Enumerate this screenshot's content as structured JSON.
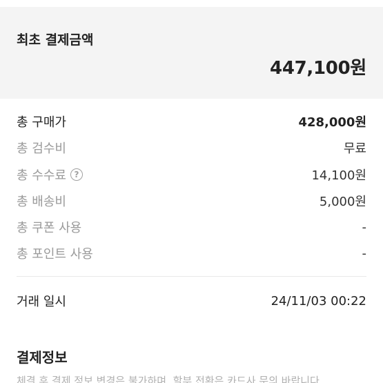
{
  "summary": {
    "title": "최초 결제금액",
    "amount": "447,100원"
  },
  "breakdown": [
    {
      "label": "총 구매가",
      "value": "428,000원"
    },
    {
      "label": "총 검수비",
      "value": "무료"
    },
    {
      "label": "총 수수료",
      "value": "14,100원",
      "icon": "question-circle-icon"
    },
    {
      "label": "총 배송비",
      "value": "5,000원"
    },
    {
      "label": "총 쿠폰 사용",
      "value": "-"
    },
    {
      "label": "총 포인트 사용",
      "value": "-"
    }
  ],
  "transaction": {
    "label": "거래 일시",
    "value": "24/11/03 00:22"
  },
  "payment_info": {
    "title": "결제정보",
    "note": "체결 후 결제 정보 변경은 불가하며, 할부 전환은 카드사 문의 바랍니다."
  }
}
